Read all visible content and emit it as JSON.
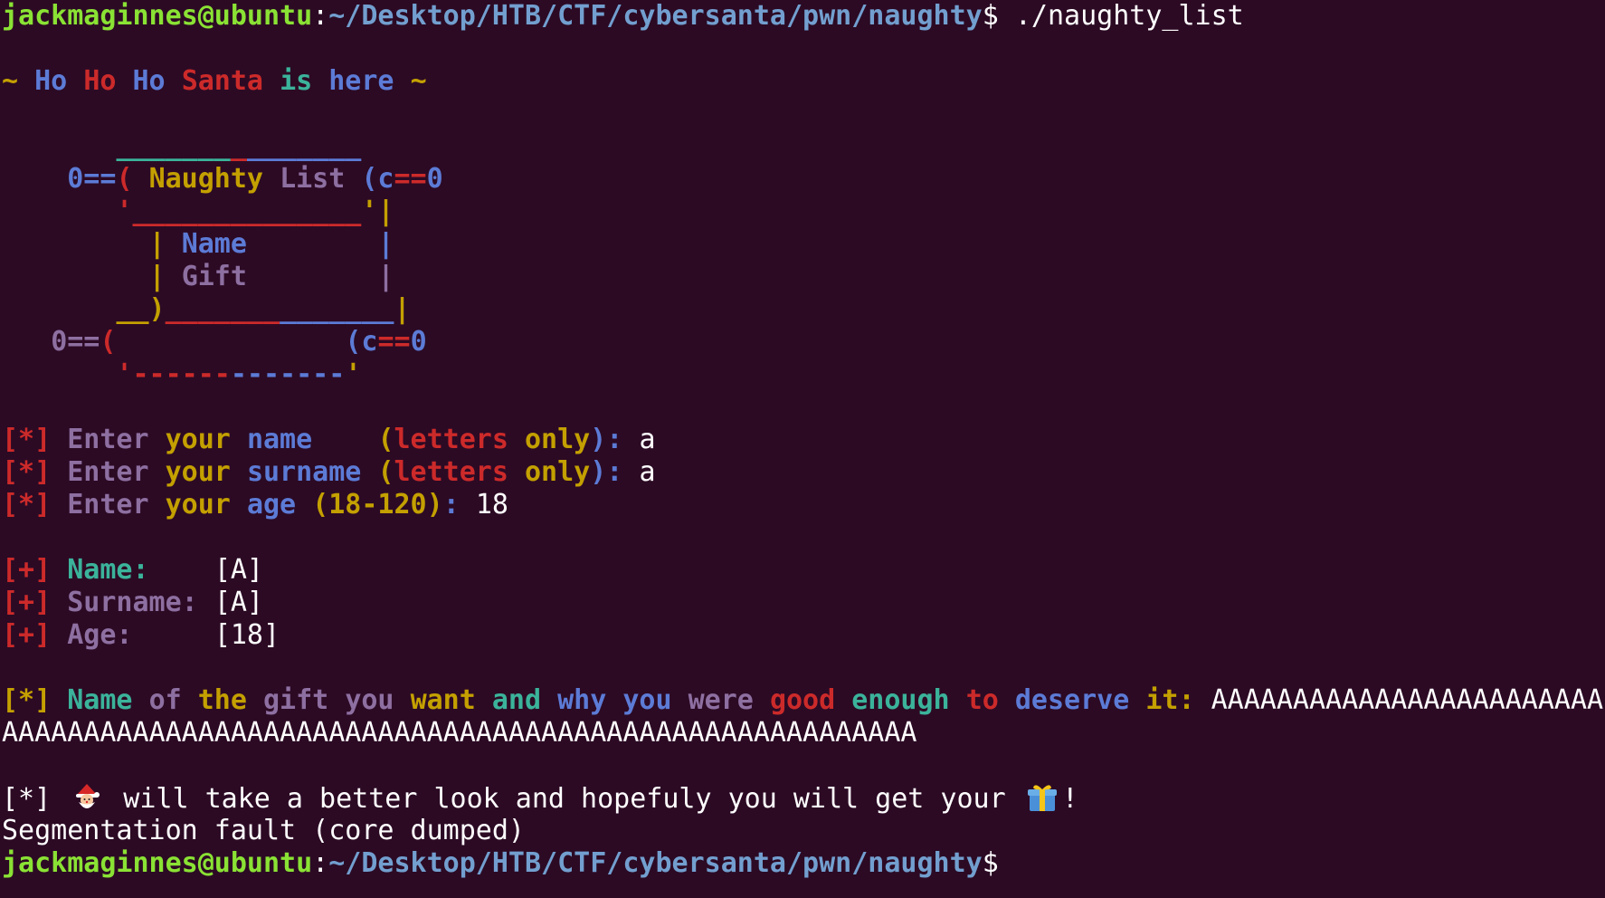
{
  "colors": {
    "background": "#2c0a24",
    "prompt_user": "#8ae234",
    "prompt_path": "#729fcf",
    "text": "#ffffff",
    "red": "#cc2a2a",
    "blue": "#5c7bd6",
    "yellow": "#c4a000",
    "green": "#3bb39b",
    "purple": "#8e6fa1"
  },
  "terminal": {
    "prompt_user_host": "jackmaginnes@ubuntu",
    "prompt_path": "~/Desktop/HTB/CTF/cybersanta/pwn/naughty",
    "prompt_dollar": "$",
    "command": " ./naughty_list",
    "lines": [
      {
        "type": "prompt",
        "command": " ./naughty_list"
      },
      {
        "type": "blank"
      },
      {
        "type": "colored",
        "segments": [
          [
            "~ ",
            "yellow"
          ],
          [
            "Ho ",
            "blue"
          ],
          [
            "Ho ",
            "red"
          ],
          [
            "Ho ",
            "blue"
          ],
          [
            "Santa ",
            "red"
          ],
          [
            "is ",
            "green"
          ],
          [
            "here ",
            "blue"
          ],
          [
            "~",
            "yellow"
          ]
        ]
      },
      {
        "type": "blank"
      },
      {
        "type": "colored",
        "segments": [
          [
            "       ",
            "blue"
          ],
          [
            "_______",
            "green"
          ],
          [
            "_",
            "red"
          ],
          [
            "_______",
            "blue"
          ]
        ]
      },
      {
        "type": "colored",
        "segments": [
          [
            "    ",
            "blue"
          ],
          [
            "0==",
            "blue"
          ],
          [
            "( ",
            "red"
          ],
          [
            "Naughty ",
            "yellow"
          ],
          [
            "List ",
            "purple"
          ],
          [
            "(c",
            "blue"
          ],
          [
            "==",
            "red"
          ],
          [
            "0",
            "blue"
          ]
        ]
      },
      {
        "type": "colored",
        "segments": [
          [
            "       ",
            "blue"
          ],
          [
            "'",
            "red"
          ],
          [
            "______________",
            "red"
          ],
          [
            "'",
            "yellow"
          ],
          [
            "|",
            "yellow"
          ]
        ]
      },
      {
        "type": "colored",
        "segments": [
          [
            "         ",
            "blue"
          ],
          [
            "| ",
            "yellow"
          ],
          [
            "Name        ",
            "blue"
          ],
          [
            "|",
            "blue"
          ]
        ]
      },
      {
        "type": "colored",
        "segments": [
          [
            "         ",
            "blue"
          ],
          [
            "| ",
            "yellow"
          ],
          [
            "Gift        ",
            "purple"
          ],
          [
            "|",
            "purple"
          ]
        ]
      },
      {
        "type": "colored",
        "segments": [
          [
            "       ",
            "blue"
          ],
          [
            "__)",
            "yellow"
          ],
          [
            "_______",
            "red"
          ],
          [
            "_______",
            "blue"
          ],
          [
            "|",
            "yellow"
          ]
        ]
      },
      {
        "type": "colored",
        "segments": [
          [
            "   ",
            "blue"
          ],
          [
            "0==",
            "purple"
          ],
          [
            "(              ",
            "red"
          ],
          [
            "(c",
            "blue"
          ],
          [
            "==",
            "red"
          ],
          [
            "0",
            "blue"
          ]
        ]
      },
      {
        "type": "colored",
        "segments": [
          [
            "       ",
            "blue"
          ],
          [
            "'",
            "red"
          ],
          [
            "------",
            "red"
          ],
          [
            "-------",
            "blue"
          ],
          [
            "'",
            "yellow"
          ]
        ]
      },
      {
        "type": "blank"
      },
      {
        "type": "colored",
        "segments": [
          [
            "[*] ",
            "red"
          ],
          [
            "Enter ",
            "purple"
          ],
          [
            "your ",
            "yellow"
          ],
          [
            "name    ",
            "blue"
          ],
          [
            "(",
            "yellow"
          ],
          [
            "letters ",
            "red"
          ],
          [
            "only",
            "yellow"
          ],
          [
            "): ",
            "blue"
          ],
          [
            "a",
            "white"
          ]
        ]
      },
      {
        "type": "colored",
        "segments": [
          [
            "[*] ",
            "red"
          ],
          [
            "Enter ",
            "purple"
          ],
          [
            "your ",
            "yellow"
          ],
          [
            "surname ",
            "blue"
          ],
          [
            "(",
            "yellow"
          ],
          [
            "letters ",
            "red"
          ],
          [
            "only",
            "yellow"
          ],
          [
            "): ",
            "blue"
          ],
          [
            "a",
            "white"
          ]
        ]
      },
      {
        "type": "colored",
        "segments": [
          [
            "[*] ",
            "red"
          ],
          [
            "Enter ",
            "purple"
          ],
          [
            "your ",
            "yellow"
          ],
          [
            "age ",
            "blue"
          ],
          [
            "(18-120)",
            "yellow"
          ],
          [
            ": ",
            "blue"
          ],
          [
            "18",
            "white"
          ]
        ]
      },
      {
        "type": "blank"
      },
      {
        "type": "colored",
        "segments": [
          [
            "[+] ",
            "red"
          ],
          [
            "Name:    ",
            "green"
          ],
          [
            "[A]",
            "white"
          ]
        ]
      },
      {
        "type": "colored",
        "segments": [
          [
            "[+] ",
            "red"
          ],
          [
            "Surname: ",
            "purple"
          ],
          [
            "[A]",
            "white"
          ]
        ]
      },
      {
        "type": "colored",
        "segments": [
          [
            "[+] ",
            "red"
          ],
          [
            "Age:     ",
            "purple"
          ],
          [
            "[18]",
            "white"
          ]
        ]
      },
      {
        "type": "blank"
      },
      {
        "type": "colored",
        "segments": [
          [
            "[*] ",
            "yellow"
          ],
          [
            "Name ",
            "green"
          ],
          [
            "of ",
            "purple"
          ],
          [
            "the ",
            "yellow"
          ],
          [
            "gift ",
            "purple"
          ],
          [
            "you ",
            "purple"
          ],
          [
            "want ",
            "yellow"
          ],
          [
            "and ",
            "green"
          ],
          [
            "why ",
            "blue"
          ],
          [
            "you ",
            "blue"
          ],
          [
            "were ",
            "purple"
          ],
          [
            "good ",
            "red"
          ],
          [
            "enough ",
            "green"
          ],
          [
            "to ",
            "red"
          ],
          [
            "deserve ",
            "blue"
          ],
          [
            "it: ",
            "yellow"
          ],
          [
            "AAAAAAAAAAAAAAAAAAAAAAAA",
            "white"
          ]
        ]
      },
      {
        "type": "colored",
        "segments": [
          [
            "AAAAAAAAAAAAAAAAAAAAAAAAAAAAAAAAAAAAAAAAAAAAAAAAAAAAAAAA",
            "white"
          ]
        ]
      },
      {
        "type": "blank"
      },
      {
        "type": "final",
        "prefix": "[*] ",
        "middle": " will take a better look and hopefuly you will get your ",
        "suffix": "!"
      },
      {
        "type": "colored",
        "segments": [
          [
            "Segmentation fault (core dumped)",
            "white"
          ]
        ]
      },
      {
        "type": "prompt",
        "command": ""
      }
    ]
  },
  "icons": {
    "santa": "santa-emoji-icon",
    "gift": "gift-emoji-icon"
  }
}
